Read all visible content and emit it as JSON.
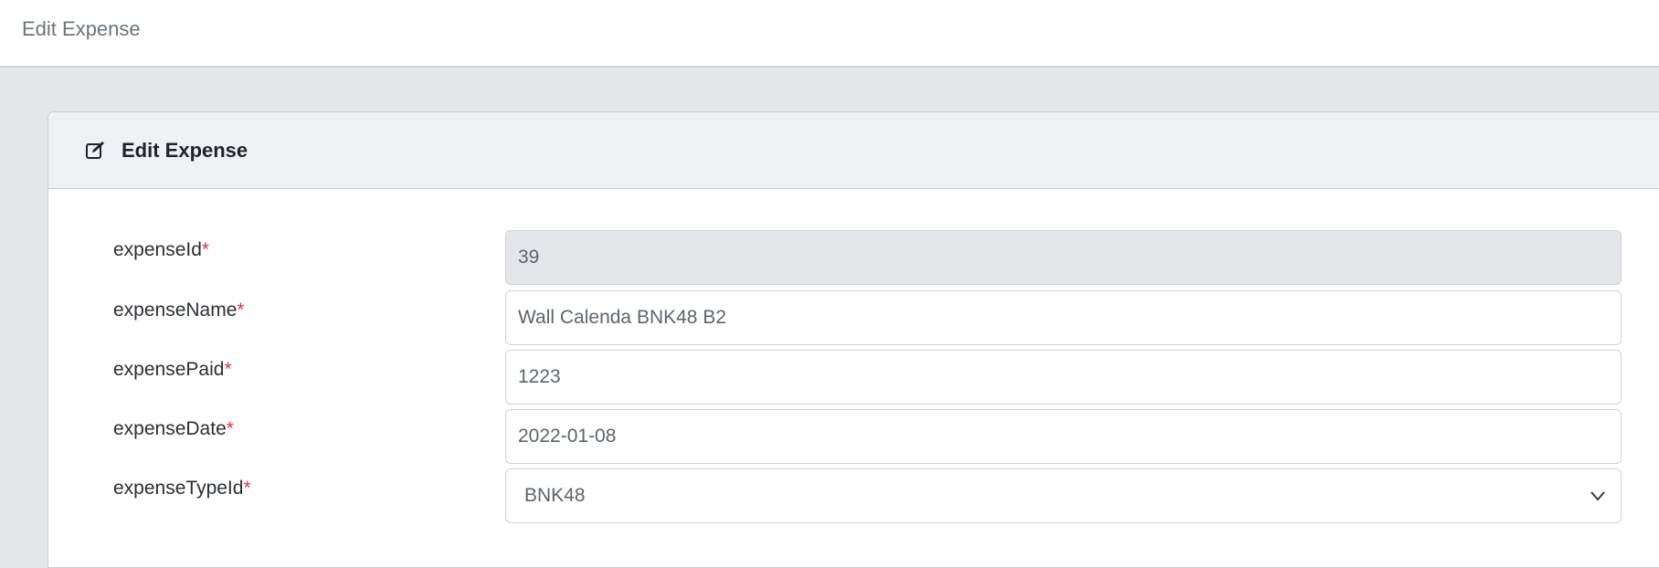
{
  "topbar": {
    "title": "Edit Expense"
  },
  "card": {
    "title": "Edit Expense",
    "icon": "edit-icon"
  },
  "form": {
    "required_mark": "*",
    "fields": [
      {
        "label": "expenseId",
        "value": "39",
        "readonly": true
      },
      {
        "label": "expenseName",
        "value": "Wall Calenda BNK48 B2"
      },
      {
        "label": "expensePaid",
        "value": "1223"
      },
      {
        "label": "expenseDate",
        "value": "2022-01-08"
      },
      {
        "label": "expenseTypeId",
        "value": "BNK48",
        "type": "select"
      }
    ]
  },
  "colors": {
    "required": "#dc3545",
    "header_bg": "#eff2f5",
    "page_bg": "#e4e6e9"
  }
}
